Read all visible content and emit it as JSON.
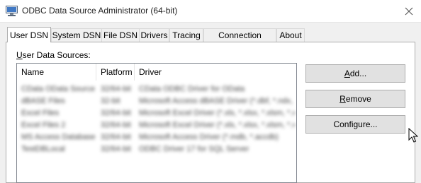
{
  "window": {
    "title": "ODBC Data Source Administrator (64-bit)"
  },
  "tabs": [
    {
      "label": "User DSN",
      "active": true
    },
    {
      "label": "System DSN",
      "active": false
    },
    {
      "label": "File DSN",
      "active": false
    },
    {
      "label": "Drivers",
      "active": false
    },
    {
      "label": "Tracing",
      "active": false
    },
    {
      "label": "Connection Pooling",
      "active": false
    },
    {
      "label": "About",
      "active": false
    }
  ],
  "user_dsn": {
    "section_label": "User Data Sources:",
    "columns": [
      "Name",
      "Platform",
      "Driver"
    ],
    "rows": [
      {
        "name": "CData OData Source",
        "platform": "32/64-bit",
        "driver": "CData ODBC Driver for OData"
      },
      {
        "name": "dBASE Files",
        "platform": "32-bit",
        "driver": "Microsoft Access dBASE Driver (*.dbf, *.ndx, *.mdx)"
      },
      {
        "name": "Excel Files",
        "platform": "32/64-bit",
        "driver": "Microsoft Excel Driver (*.xls, *.xlsx, *.xlsm, *.xlsb)"
      },
      {
        "name": "Excel Files 2",
        "platform": "32/64-bit",
        "driver": "Microsoft Excel Driver (*.xls, *.xlsx, *.xlsm, *.xlsb)"
      },
      {
        "name": "MS Access Database",
        "platform": "32/64-bit",
        "driver": "Microsoft Access Driver (*.mdb, *.accdb)"
      },
      {
        "name": "TestDBLocal",
        "platform": "32/64-bit",
        "driver": "ODBC Driver 17 for SQL Server"
      }
    ],
    "buttons": {
      "add": {
        "mnemonic": "A",
        "rest": "dd..."
      },
      "remove": {
        "mnemonic": "R",
        "rest": "emove"
      },
      "configure": {
        "mnemonic": "",
        "rest": "Configure..."
      }
    }
  }
}
